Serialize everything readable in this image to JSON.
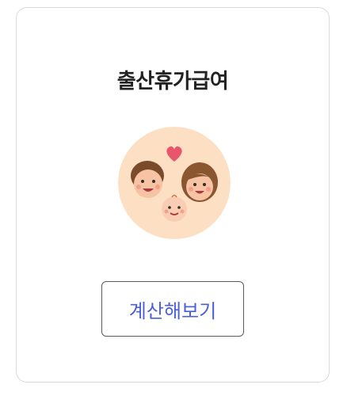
{
  "card": {
    "title": "출산휴가급여",
    "illustration_icon": "family-with-baby-icon",
    "button_label": "계산해보기"
  },
  "colors": {
    "title_text": "#222222",
    "button_text": "#4b5fd6",
    "button_border": "#5a5a60",
    "card_border": "#d9d9de",
    "illustration_bg": "#fde0c4"
  }
}
